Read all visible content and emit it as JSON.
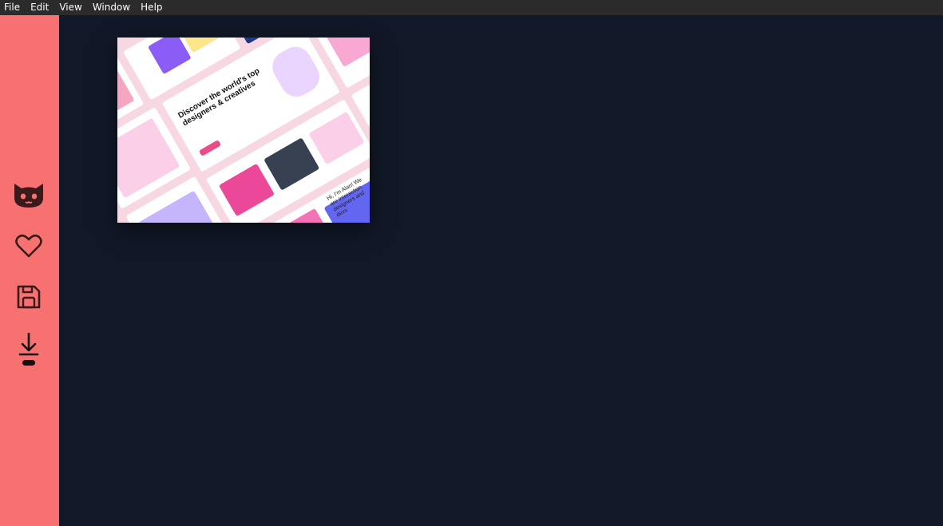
{
  "menubar": {
    "items": [
      "File",
      "Edit",
      "View",
      "Window",
      "Help"
    ]
  },
  "sidebar": {
    "buttons": [
      {
        "icon": "cat-icon"
      },
      {
        "icon": "heart-icon"
      },
      {
        "icon": "save-icon"
      },
      {
        "icon": "download-icon"
      }
    ]
  },
  "thumbnail": {
    "headline": "Discover the world's top designers & creatives",
    "side_text": "Hi, I'm Alan! We are interaction designers and devs"
  },
  "colors": {
    "sidebar": "#f87171",
    "background": "#111827",
    "menubar": "#2b2b2b",
    "icon_stroke": "#3a1a1a",
    "accent_pink": "#ea4c89"
  }
}
